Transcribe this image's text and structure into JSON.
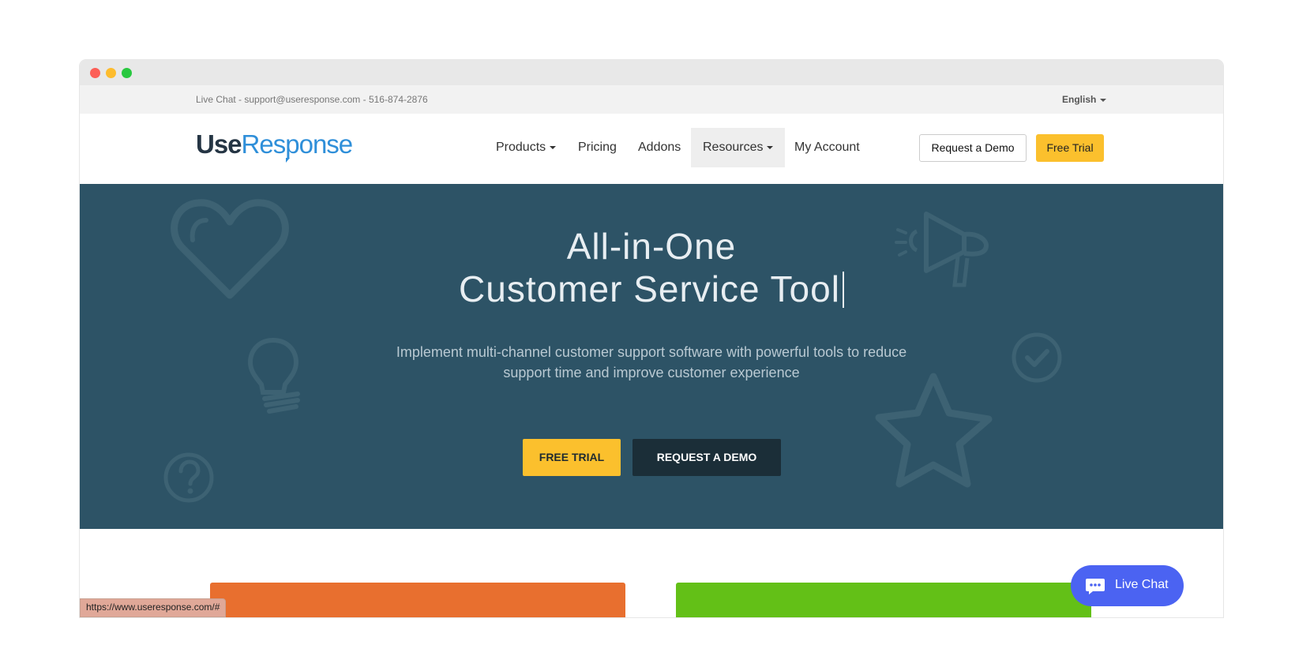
{
  "topbar": {
    "contact": "Live Chat - support@useresponse.com - 516-874-2876",
    "language": "English"
  },
  "logo": {
    "part1": "Use",
    "part2": "Response"
  },
  "nav": {
    "products": "Products",
    "pricing": "Pricing",
    "addons": "Addons",
    "resources": "Resources",
    "account": "My Account",
    "request_demo": "Request a Demo",
    "free_trial": "Free Trial"
  },
  "hero": {
    "title_line1": "All-in-One",
    "title_line2": "Customer Service Tool",
    "subtitle": "Implement multi-channel customer support software with powerful tools to reduce support time and improve customer experience",
    "cta_trial": "FREE TRIAL",
    "cta_demo": "REQUEST A DEMO"
  },
  "status_bar": {
    "url": "https://www.useresponse.com/#"
  },
  "live_chat": {
    "label": "Live Chat"
  },
  "colors": {
    "hero_bg": "#2d5366",
    "accent_yellow": "#fbc02d",
    "brand_blue": "#2f8fd9",
    "card_orange": "#e86f2f",
    "card_green": "#63c017",
    "chat_blue": "#4b63f2"
  },
  "icons": [
    "heart-icon",
    "lightbulb-icon",
    "question-icon",
    "megaphone-icon",
    "check-circle-icon",
    "star-icon",
    "chat-bubble-icon"
  ]
}
